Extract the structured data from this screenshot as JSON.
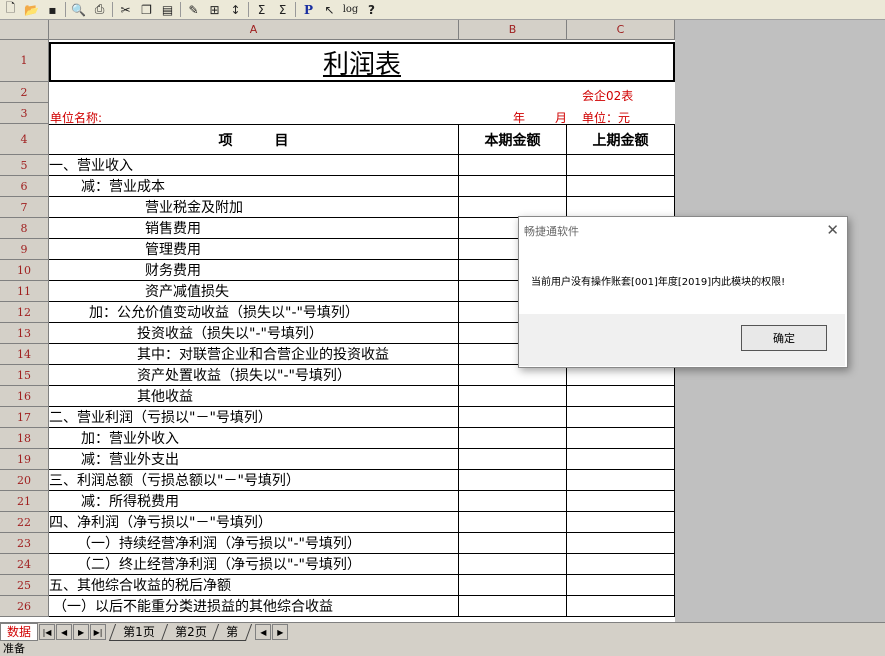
{
  "toolbar": {
    "icons": [
      "new-file-icon",
      "open-folder-icon",
      "save-icon",
      "print-preview-icon",
      "print-icon",
      "cut-icon",
      "copy-icon",
      "paste-icon",
      "format-icon",
      "fill-icon",
      "sort-icon",
      "sum-icon",
      "sum-dropdown-icon",
      "p-icon",
      "cursor-icon",
      "log-icon",
      "help-icon"
    ],
    "p_label": "P",
    "log_label": "log"
  },
  "columns": [
    "A",
    "B",
    "C"
  ],
  "report": {
    "title": "利润表",
    "form_code": "会企02表",
    "unit_name_label": "单位名称:",
    "year_label": "年",
    "month_label": "月",
    "unit_label": "单位：元",
    "header_item": "项　　　目",
    "header_current": "本期金额",
    "header_previous": "上期金额"
  },
  "row_numbers": [
    "1",
    "2",
    "3",
    "4",
    "5",
    "6",
    "7",
    "8",
    "9",
    "10",
    "11",
    "12",
    "13",
    "14",
    "15",
    "16",
    "17",
    "18",
    "19",
    "20",
    "21",
    "22",
    "23",
    "24",
    "25",
    "26"
  ],
  "items": [
    {
      "row": "5",
      "text": "一、营业收入",
      "indent": 0
    },
    {
      "row": "6",
      "text": "减：营业成本",
      "indent": 32
    },
    {
      "row": "7",
      "text": "营业税金及附加",
      "indent": 96
    },
    {
      "row": "8",
      "text": "销售费用",
      "indent": 96
    },
    {
      "row": "9",
      "text": "管理费用",
      "indent": 96
    },
    {
      "row": "10",
      "text": "财务费用",
      "indent": 96
    },
    {
      "row": "11",
      "text": "资产减值损失",
      "indent": 96
    },
    {
      "row": "12",
      "text": "加：公允价值变动收益（损失以\"-\"号填列）",
      "indent": 40
    },
    {
      "row": "13",
      "text": "投资收益（损失以\"-\"号填列）",
      "indent": 88
    },
    {
      "row": "14",
      "text": "其中：对联营企业和合营企业的投资收益",
      "indent": 88
    },
    {
      "row": "15",
      "text": "资产处置收益（损失以\"-\"号填列）",
      "indent": 88
    },
    {
      "row": "16",
      "text": "其他收益",
      "indent": 88
    },
    {
      "row": "17",
      "text": "二、营业利润（亏损以\"－\"号填列）",
      "indent": 0
    },
    {
      "row": "18",
      "text": "加：营业外收入",
      "indent": 32
    },
    {
      "row": "19",
      "text": "减：营业外支出",
      "indent": 32
    },
    {
      "row": "20",
      "text": "三、利润总额（亏损总额以\"－\"号填列）",
      "indent": 0
    },
    {
      "row": "21",
      "text": "减：所得税费用",
      "indent": 32
    },
    {
      "row": "22",
      "text": "四、净利润（净亏损以\"－\"号填列）",
      "indent": 0
    },
    {
      "row": "23",
      "text": "（一）持续经营净利润（净亏损以\"-\"号填列）",
      "indent": 28
    },
    {
      "row": "24",
      "text": "（二）终止经营净利润（净亏损以\"-\"号填列）",
      "indent": 28
    },
    {
      "row": "25",
      "text": "五、其他综合收益的税后净额",
      "indent": 0
    },
    {
      "row": "26",
      "text": "（一）以后不能重分类进损益的其他综合收益",
      "indent": 4
    }
  ],
  "tabs": {
    "data_tab": "数据",
    "sheets": [
      "第1页",
      "第2页",
      "第"
    ]
  },
  "status": "准备",
  "dialog": {
    "title": "畅捷通软件",
    "message": "当前用户没有操作账套[001]年度[2019]内此模块的权限!",
    "ok_label": "确定"
  }
}
